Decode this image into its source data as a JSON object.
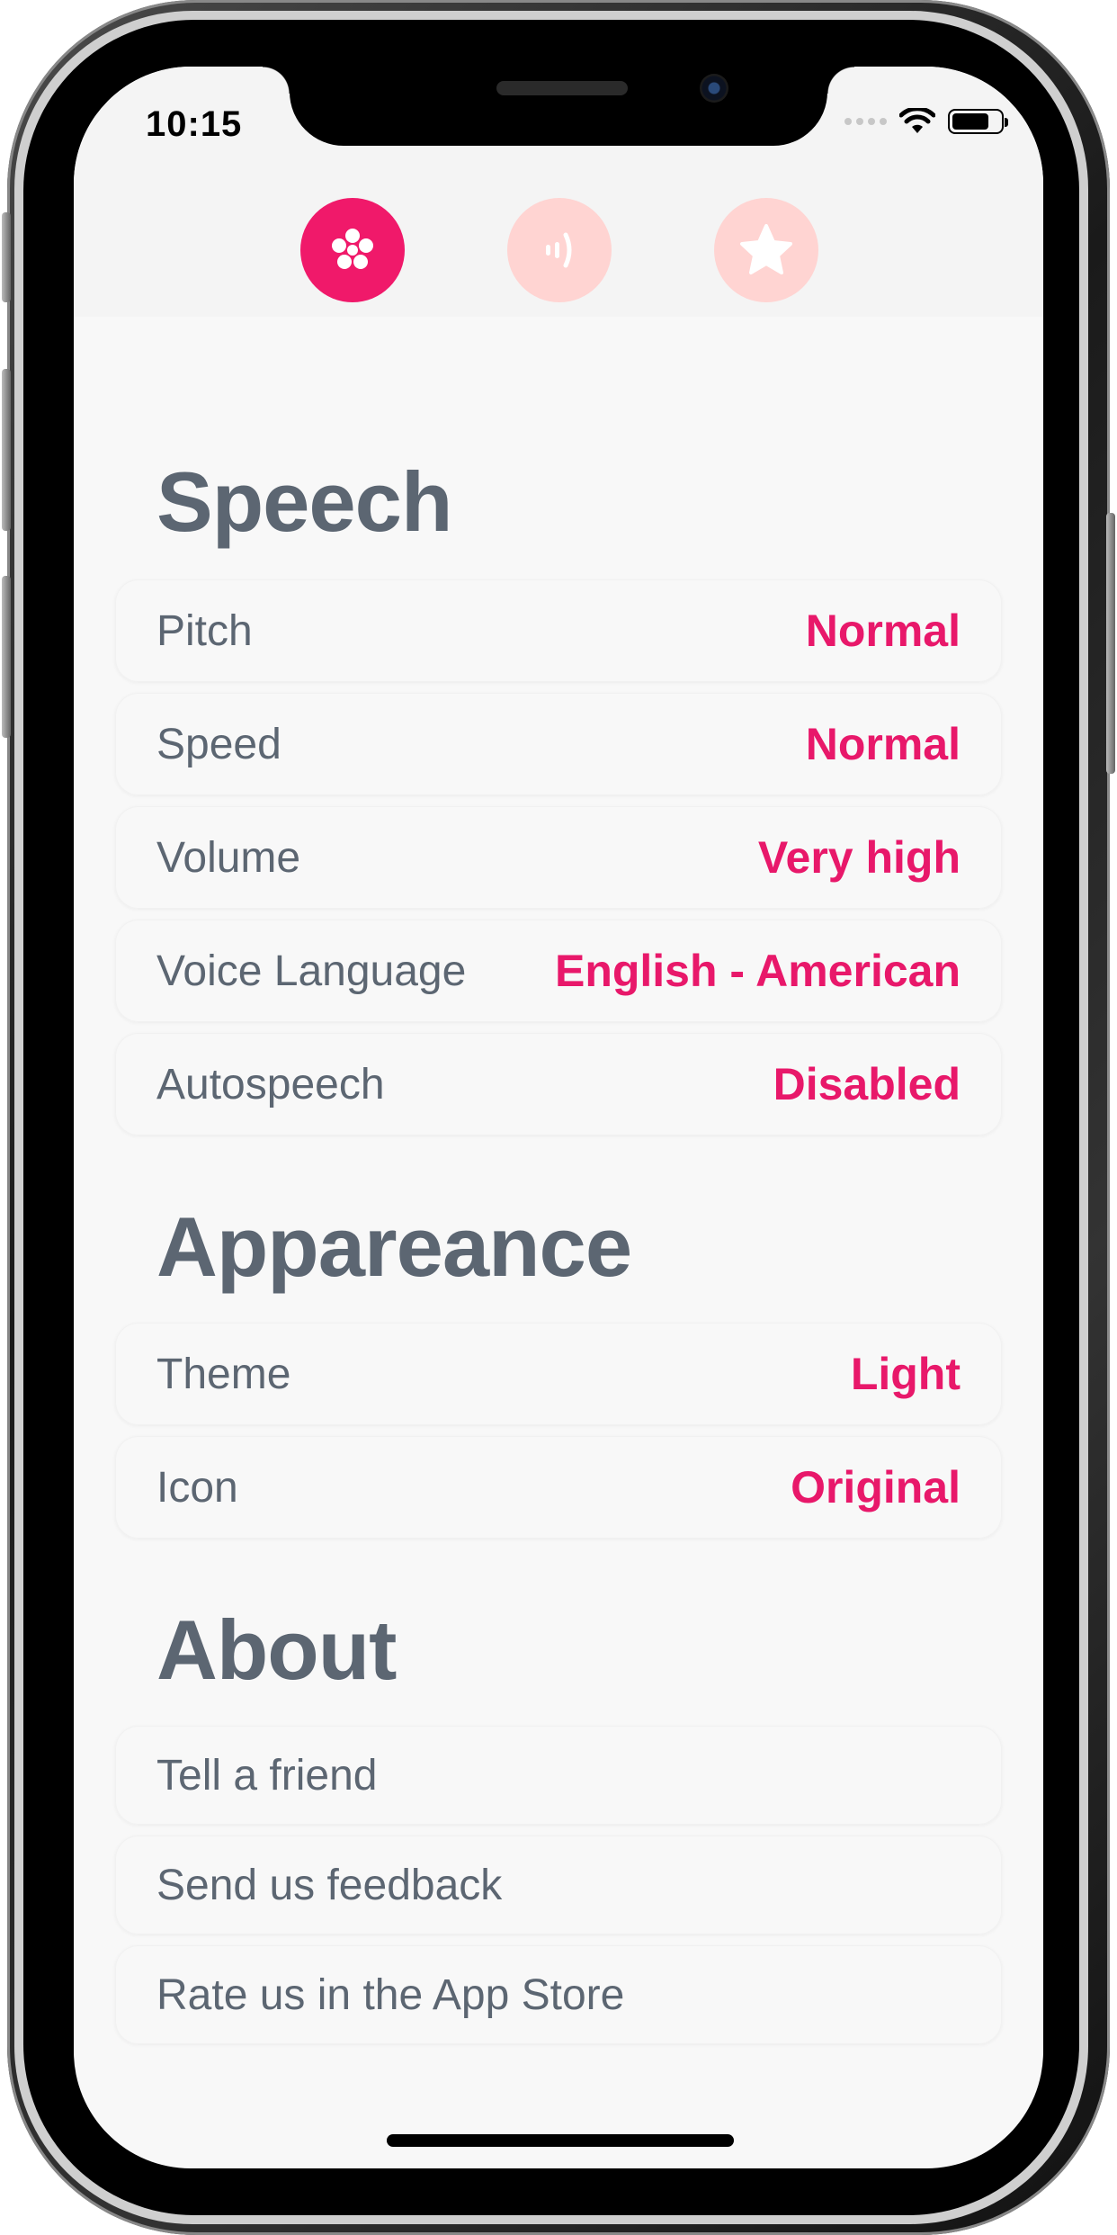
{
  "status_bar": {
    "time": "10:15",
    "icons": [
      "signal-dots-icon",
      "wifi-icon",
      "battery-icon"
    ]
  },
  "top_nav": {
    "tabs": [
      {
        "icon": "flower-icon",
        "active": true
      },
      {
        "icon": "sound-wave-icon",
        "active": false
      },
      {
        "icon": "star-icon",
        "active": false
      }
    ]
  },
  "colors": {
    "accent": "#e8186a",
    "accent_bg_active": "#f0196a",
    "accent_bg_inactive": "#ffd4d2",
    "text": "#5c6672",
    "background": "#f8f8f8"
  },
  "sections": {
    "speech": {
      "title": "Speech",
      "rows": [
        {
          "label": "Pitch",
          "value": "Normal"
        },
        {
          "label": "Speed",
          "value": "Normal"
        },
        {
          "label": "Volume",
          "value": "Very high"
        },
        {
          "label": "Voice Language",
          "value": "English - American"
        },
        {
          "label": "Autospeech",
          "value": "Disabled"
        }
      ]
    },
    "appearance": {
      "title": "Appareance",
      "rows": [
        {
          "label": "Theme",
          "value": "Light"
        },
        {
          "label": "Icon",
          "value": "Original"
        }
      ]
    },
    "about": {
      "title": "About",
      "rows": [
        {
          "label": "Tell a friend"
        },
        {
          "label": "Send us feedback"
        },
        {
          "label": "Rate us in the App Store"
        }
      ]
    }
  }
}
